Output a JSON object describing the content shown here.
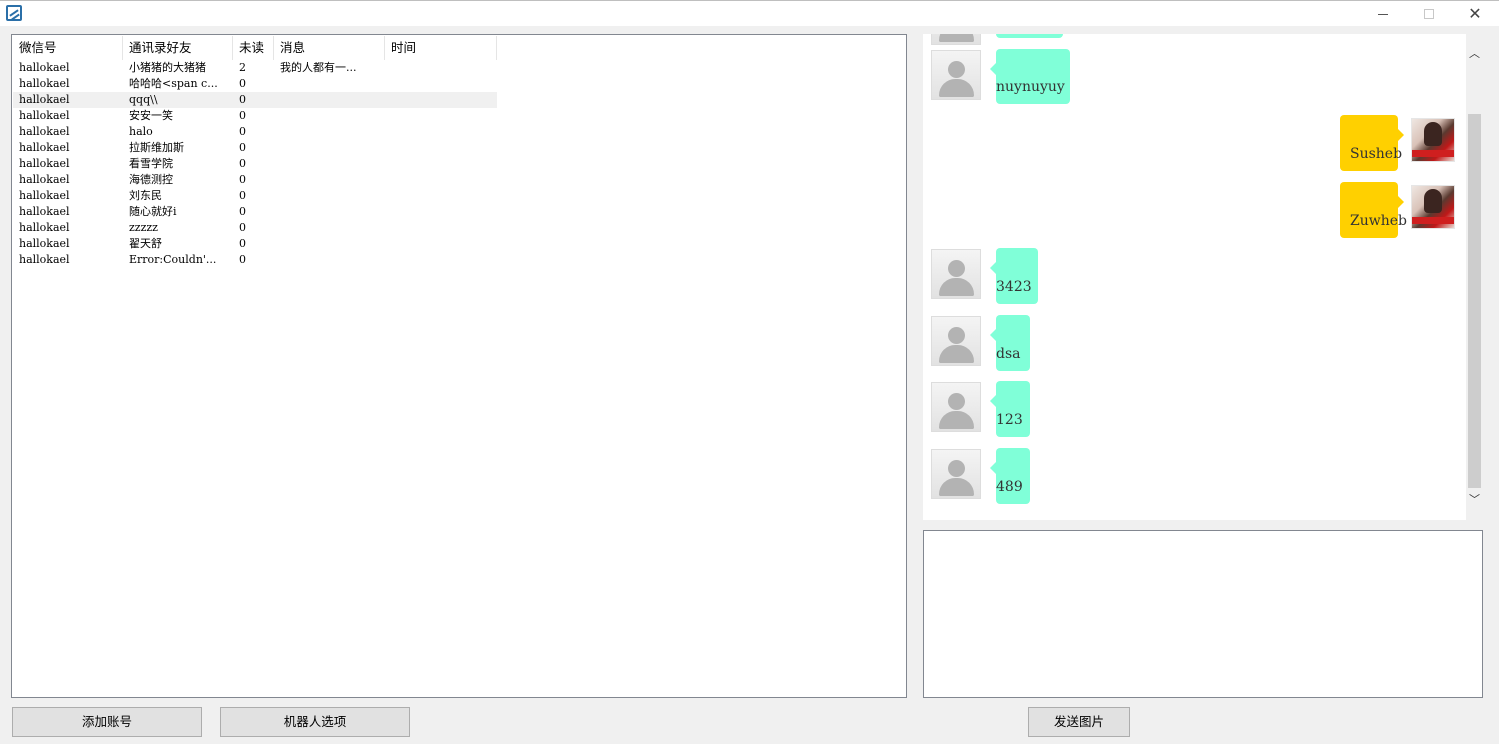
{
  "window": {
    "title": "",
    "controls": {
      "minimize": "",
      "maximize": "",
      "close": "✕"
    }
  },
  "list": {
    "columns": [
      "微信号",
      "通讯录好友",
      "未读",
      "消息",
      "时间"
    ],
    "rows": [
      {
        "wechat_id": "hallokael",
        "friend": "小猪猪的大猪猪",
        "unread": "2",
        "message": "我的人都有一...",
        "time": ""
      },
      {
        "wechat_id": "hallokael",
        "friend": "哈哈哈<span c...",
        "unread": "0",
        "message": "",
        "time": ""
      },
      {
        "wechat_id": "hallokael",
        "friend": "qqq\\\\",
        "unread": "0",
        "message": "",
        "time": ""
      },
      {
        "wechat_id": "hallokael",
        "friend": "安安一笑",
        "unread": "0",
        "message": "",
        "time": ""
      },
      {
        "wechat_id": "hallokael",
        "friend": "halo",
        "unread": "0",
        "message": "",
        "time": ""
      },
      {
        "wechat_id": "hallokael",
        "friend": "拉斯维加斯",
        "unread": "0",
        "message": "",
        "time": ""
      },
      {
        "wechat_id": "hallokael",
        "friend": "看雪学院",
        "unread": "0",
        "message": "",
        "time": ""
      },
      {
        "wechat_id": "hallokael",
        "friend": "海德测控",
        "unread": "0",
        "message": "",
        "time": ""
      },
      {
        "wechat_id": "hallokael",
        "friend": "刘东民",
        "unread": "0",
        "message": "",
        "time": ""
      },
      {
        "wechat_id": "hallokael",
        "friend": "随心就好i",
        "unread": "0",
        "message": "",
        "time": ""
      },
      {
        "wechat_id": "hallokael",
        "friend": "zzzzz",
        "unread": "0",
        "message": "",
        "time": ""
      },
      {
        "wechat_id": "hallokael",
        "friend": "翟天舒",
        "unread": "0",
        "message": "",
        "time": ""
      },
      {
        "wechat_id": "hallokael",
        "friend": "Error:Couldn'...",
        "unread": "0",
        "message": "",
        "time": ""
      }
    ],
    "selected_index": 2
  },
  "chat": {
    "messages": [
      {
        "direction": "in",
        "text": ""
      },
      {
        "direction": "in",
        "text": "nuynuyuy"
      },
      {
        "direction": "out",
        "text": "Susheb"
      },
      {
        "direction": "out",
        "text": "Zuwheb"
      },
      {
        "direction": "in",
        "text": "3423"
      },
      {
        "direction": "in",
        "text": "dsa"
      },
      {
        "direction": "in",
        "text": "123"
      },
      {
        "direction": "in",
        "text": "489"
      }
    ],
    "scroll_up": "︿",
    "scroll_down": "﹀",
    "colors": {
      "incoming": "#80ffd8",
      "outgoing": "#ffd000"
    }
  },
  "input": {
    "value": ""
  },
  "buttons": {
    "add_account": "添加账号",
    "robot_options": "机器人选项",
    "send_image": "发送图片"
  }
}
